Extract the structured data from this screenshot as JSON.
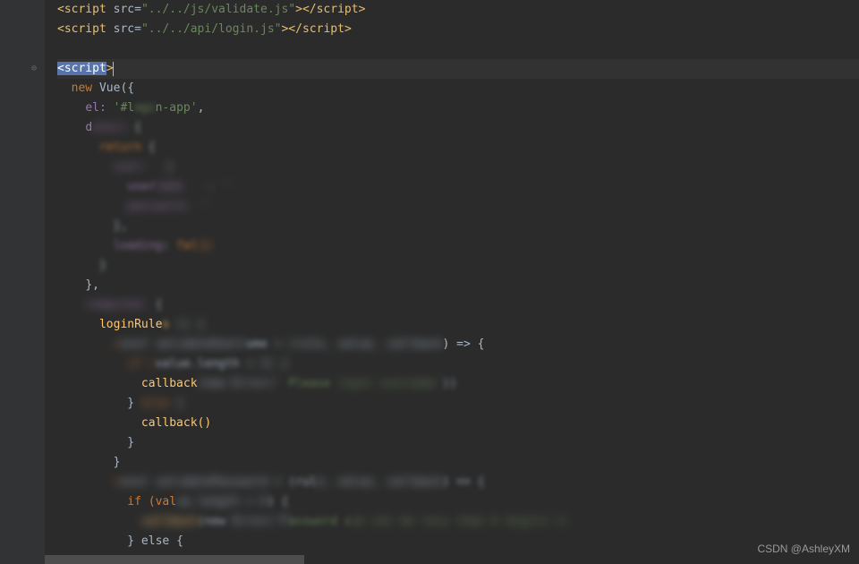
{
  "watermark": "CSDN @AshleyXM",
  "gutter": {
    "fold_icon_glyph": "⊖"
  },
  "code": {
    "l1_open": "<script",
    "l1_attr": " src=",
    "l1_str": "\"../../js/validate.js\"",
    "l1_close": "></",
    "l1_tag2": "script",
    "l1_end": ">",
    "l2_open": "<script",
    "l2_attr": " src=",
    "l2_str": "\"../../api/login.js\"",
    "l2_close": "></",
    "l2_tag2": "script",
    "l2_end": ">",
    "l4_sel": "<script",
    "l4_gt": ">",
    "l5_new": "new ",
    "l5_vue": "Vue",
    "l5_paren": "({",
    "l6_el": "el: ",
    "l6_elstr": "'#l",
    "l6_elstr2": "n-app'",
    "l6_comma": ",",
    "l7": "d",
    "l7b": " {",
    "l8": "return",
    "l8b": " {",
    "l9": "user:",
    "l9b": "'',",
    "l10a": "user",
    "l10b": "',",
    "l11a": "pass",
    "l11b": ":",
    "l11c": "''",
    "l12": "},",
    "l13": "loading",
    "l13b": " fal",
    "l14": "}",
    "l15": "},",
    "l16": "computed:",
    "l16b": " {",
    "l17": "loginRule",
    "l17b": "",
    "l18a": "c",
    "l18b": "ume",
    "l18c": ") => {",
    "l19": "value.length",
    "l20a": "callback",
    "l20b": " Please",
    "l20c": ")",
    "l21": "}",
    "l21b": " else",
    "l22": "callback()",
    "l23": "}",
    "l24": "}",
    "l25a": "c",
    "l25b": "(rul",
    "l25c": ") => {",
    "l26": "if (val",
    "l26b": ") {",
    "l27a": "(new",
    "l27b": "assword c",
    "l28": "} else {"
  }
}
